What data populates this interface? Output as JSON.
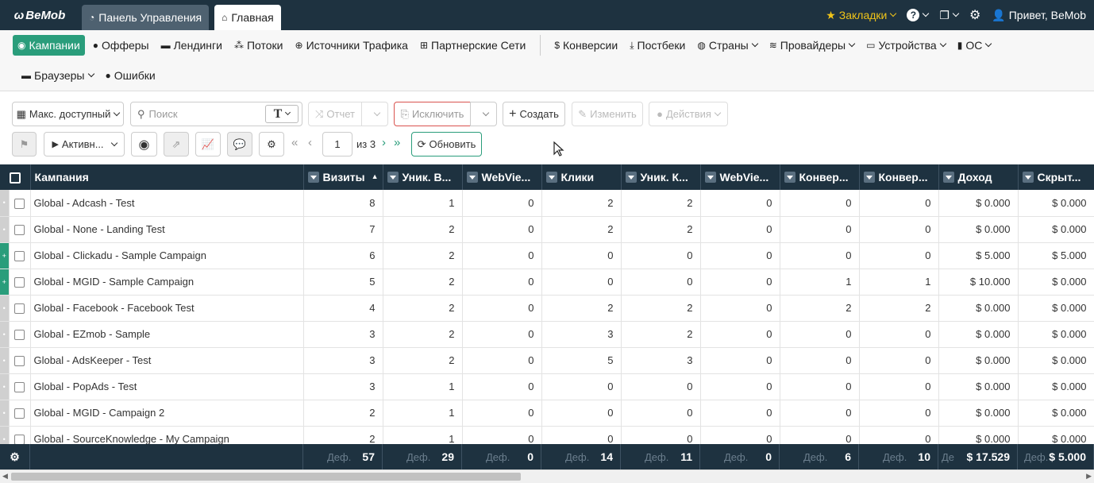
{
  "app": {
    "logo": "BeMob"
  },
  "tabs": [
    {
      "label": "Панель Управления",
      "icon": "dashboard-icon"
    },
    {
      "label": "Главная",
      "icon": "home-icon"
    }
  ],
  "topright": {
    "bookmarks": "Закладки",
    "greeting": "Привет, BeMob"
  },
  "nav": {
    "row1": [
      "Кампании",
      "Офферы",
      "Лендинги",
      "Потоки",
      "Источники Трафика",
      "Партнерские Сети"
    ],
    "row1b": [
      "Конверсии",
      "Постбеки",
      "Страны",
      "Провайдеры",
      "Устройства",
      "ОС"
    ],
    "row2": [
      "Браузеры",
      "Ошибки"
    ]
  },
  "toolbar": {
    "date_range": "Макс. доступный",
    "search_placeholder": "Поиск",
    "report": "Отчет",
    "exclude": "Исключить",
    "create": "Создать",
    "edit": "Изменить",
    "actions": "Действия",
    "status_filter": "Активн...",
    "page": "1",
    "page_of": "из 3",
    "refresh": "Обновить"
  },
  "table": {
    "columns": [
      "Кампания",
      "Визиты",
      "Уник. В...",
      "WebVie...",
      "Клики",
      "Уник. К...",
      "WebVie...",
      "Конвер...",
      "Конвер...",
      "Доход",
      "Скрыт..."
    ],
    "rows": [
      {
        "handle": "",
        "name": "Global - Adcash - Test",
        "v": [
          "8",
          "1",
          "0",
          "2",
          "2",
          "0",
          "0",
          "0",
          "$ 0.000",
          "$ 0.000"
        ]
      },
      {
        "handle": "",
        "name": "Global - None - Landing Test",
        "v": [
          "7",
          "2",
          "0",
          "2",
          "2",
          "0",
          "0",
          "0",
          "$ 0.000",
          "$ 0.000"
        ]
      },
      {
        "handle": "+",
        "name": "Global - Clickadu - Sample Campaign",
        "v": [
          "6",
          "2",
          "0",
          "0",
          "0",
          "0",
          "0",
          "0",
          "$ 5.000",
          "$ 5.000"
        ]
      },
      {
        "handle": "+",
        "name": "Global - MGID - Sample Campaign",
        "v": [
          "5",
          "2",
          "0",
          "0",
          "0",
          "0",
          "1",
          "1",
          "$ 10.000",
          "$ 0.000"
        ]
      },
      {
        "handle": "",
        "name": "Global - Facebook - Facebook Test",
        "v": [
          "4",
          "2",
          "0",
          "2",
          "2",
          "0",
          "2",
          "2",
          "$ 0.000",
          "$ 0.000"
        ]
      },
      {
        "handle": "",
        "name": "Global - EZmob - Sample",
        "v": [
          "3",
          "2",
          "0",
          "3",
          "2",
          "0",
          "0",
          "0",
          "$ 0.000",
          "$ 0.000"
        ]
      },
      {
        "handle": "",
        "name": "Global - AdsKeeper - Test",
        "v": [
          "3",
          "2",
          "0",
          "5",
          "3",
          "0",
          "0",
          "0",
          "$ 0.000",
          "$ 0.000"
        ]
      },
      {
        "handle": "",
        "name": "Global - PopAds - Test",
        "v": [
          "3",
          "1",
          "0",
          "0",
          "0",
          "0",
          "0",
          "0",
          "$ 0.000",
          "$ 0.000"
        ]
      },
      {
        "handle": "",
        "name": "Global - MGID - Campaign 2",
        "v": [
          "2",
          "1",
          "0",
          "0",
          "0",
          "0",
          "0",
          "0",
          "$ 0.000",
          "$ 0.000"
        ]
      },
      {
        "handle": "",
        "name": "Global - SourceKnowledge - My Campaign",
        "v": [
          "2",
          "1",
          "0",
          "0",
          "0",
          "0",
          "0",
          "0",
          "$ 0.000",
          "$ 0.000"
        ]
      }
    ],
    "totals_prefix": "Деф.",
    "totals_prefix_short": "Де",
    "totals": [
      "57",
      "29",
      "0",
      "14",
      "11",
      "0",
      "6",
      "10",
      "$ 17.529",
      "$ 5.000"
    ]
  },
  "colors": {
    "header": "#1e3240",
    "accent": "#2a9d7b",
    "bookmarks": "#f0c419"
  }
}
